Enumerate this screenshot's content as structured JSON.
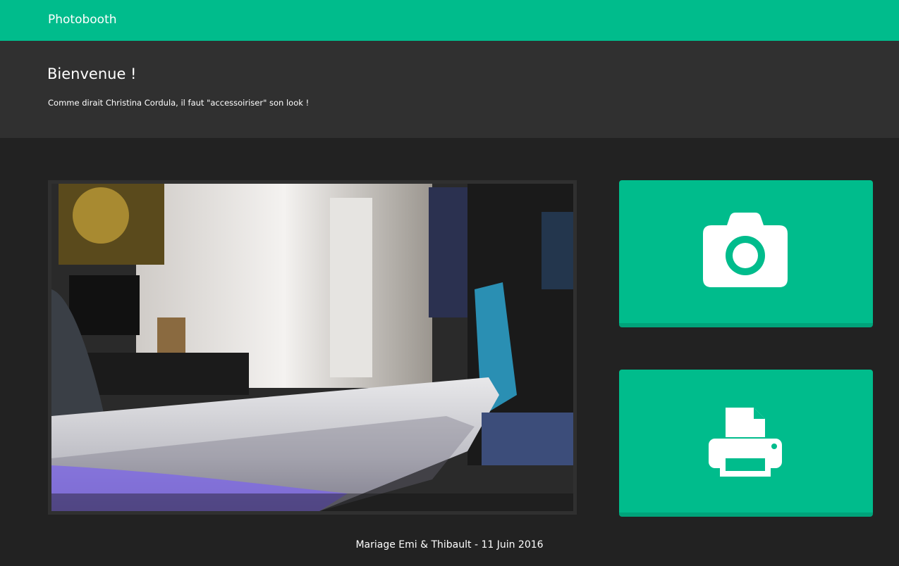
{
  "navbar": {
    "brand": "Photobooth"
  },
  "jumbotron": {
    "title": "Bienvenue !",
    "text": "Comme dirait Christina Cordula, il faut \"accessoiriser\" son look !"
  },
  "preview": {
    "description": "live-camera-preview"
  },
  "actions": {
    "photo_icon": "camera-icon",
    "print_icon": "printer-icon"
  },
  "footer": {
    "text": "Mariage Emi & Thibault - 11 Juin 2016"
  },
  "colors": {
    "accent": "#00bc8c",
    "accent_dark": "#00a37a",
    "background": "#222222",
    "jumbotron": "#303030"
  }
}
